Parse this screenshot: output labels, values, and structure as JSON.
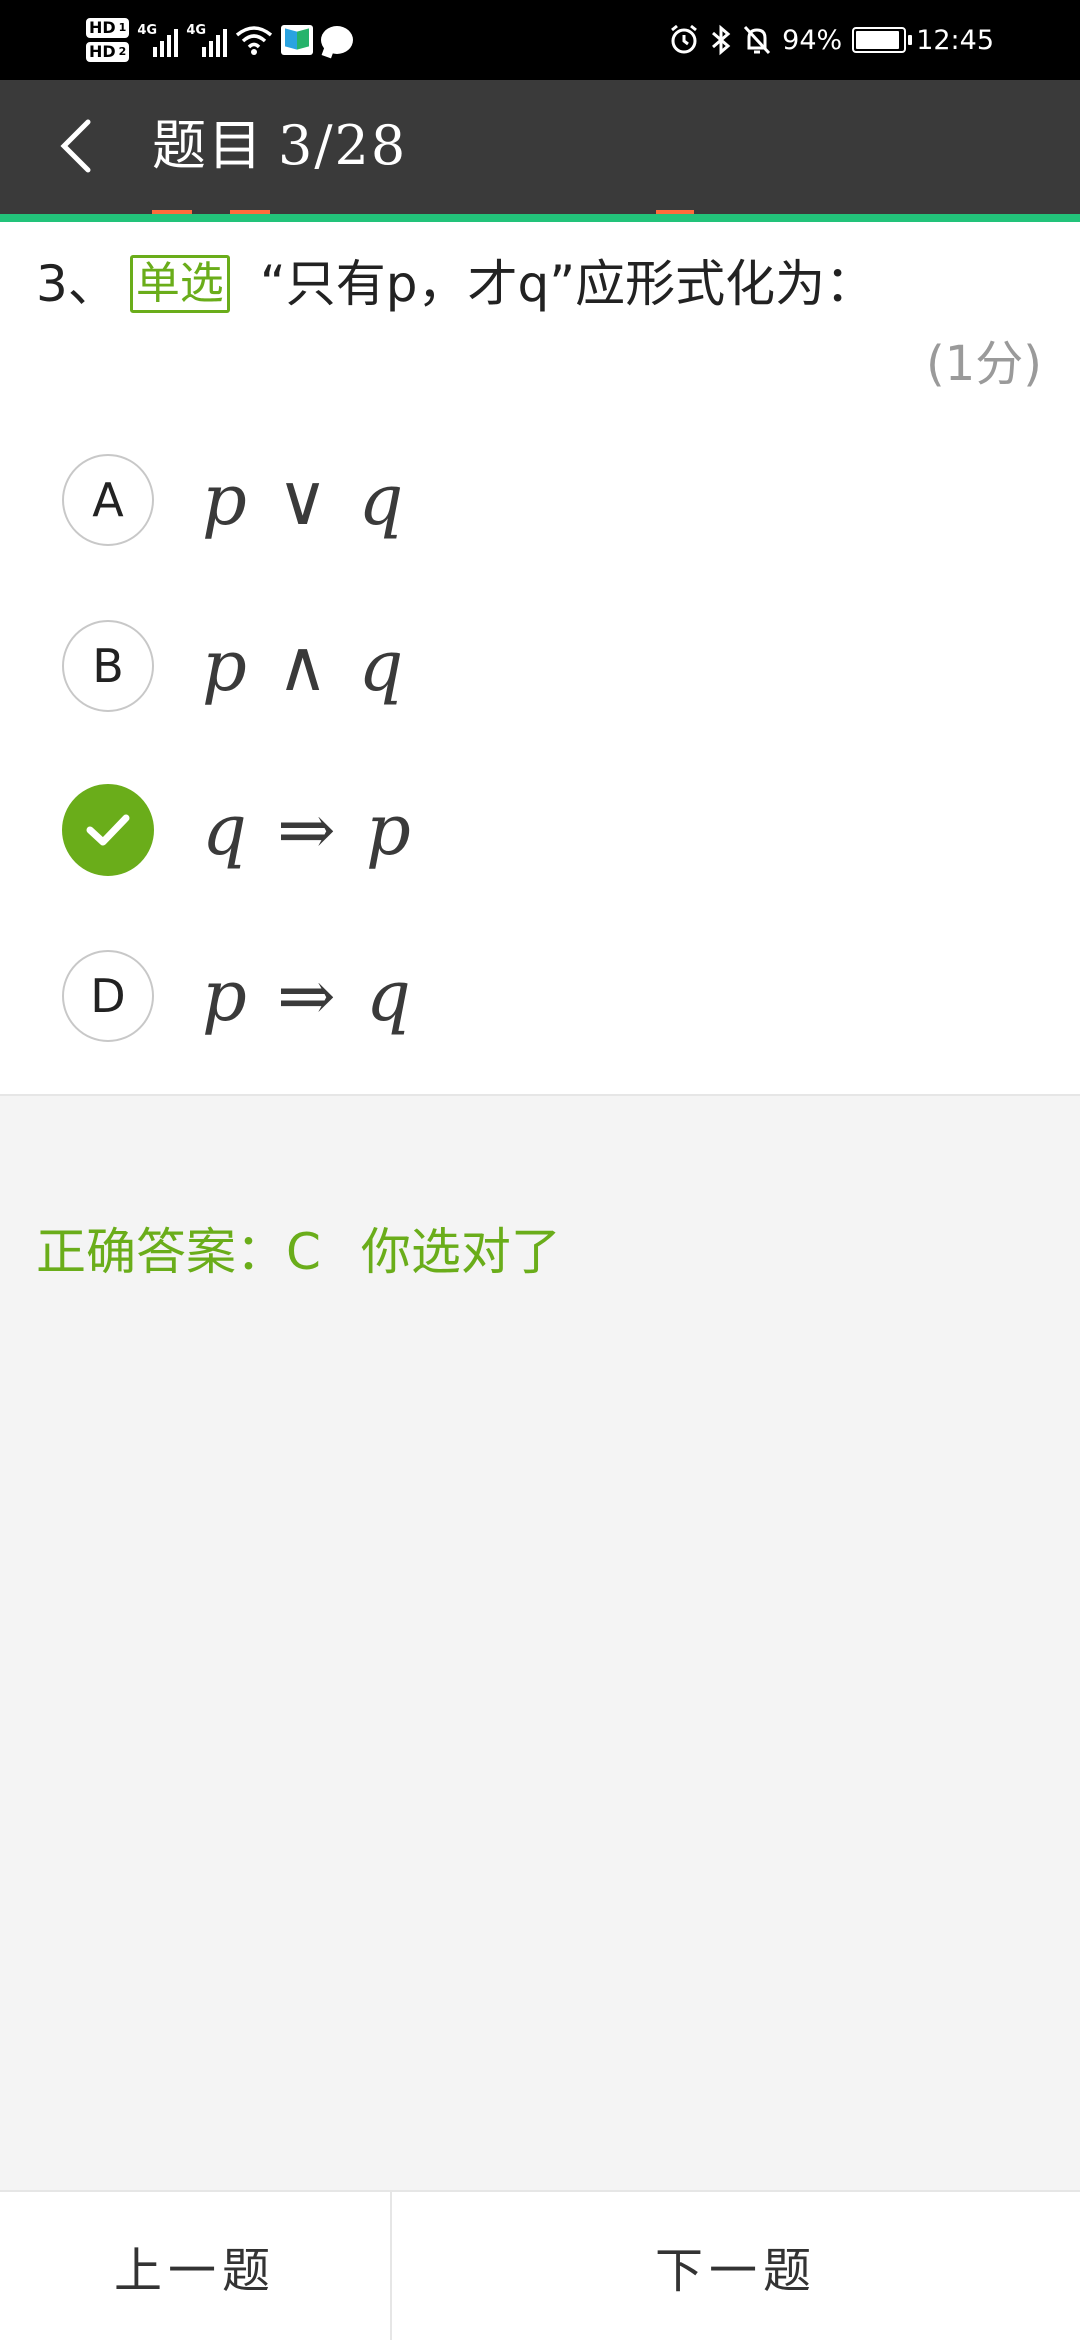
{
  "status_bar": {
    "sim1": "HD",
    "sim1_num": "1",
    "sim2": "HD",
    "sim2_num": "2",
    "network1": "4G",
    "network2": "4G",
    "battery": "94%",
    "battery_level": 0.94,
    "time": "12:45"
  },
  "header": {
    "title": "题目",
    "progress": "3/28"
  },
  "question": {
    "number": "3、",
    "type_tag": "单选",
    "text": "“只有p，才q”应形式化为：",
    "score": "(1分)"
  },
  "options": [
    {
      "letter": "A",
      "formula": "p ∨ q",
      "selected": false
    },
    {
      "letter": "B",
      "formula": "p ∧ q",
      "selected": false
    },
    {
      "letter": "C",
      "formula": "q ⇒ p",
      "selected": true
    },
    {
      "letter": "D",
      "formula": "p ⇒ q",
      "selected": false
    }
  ],
  "answer": {
    "label": "正确答案：C",
    "result": "你选对了"
  },
  "nav": {
    "prev": "上一题",
    "next": "下一题"
  },
  "colors": {
    "accent_green": "#6aad1a",
    "header_bg": "#3a3a3a",
    "progress_line": "#22c37a",
    "tab_marker": "#ff6b3a"
  }
}
